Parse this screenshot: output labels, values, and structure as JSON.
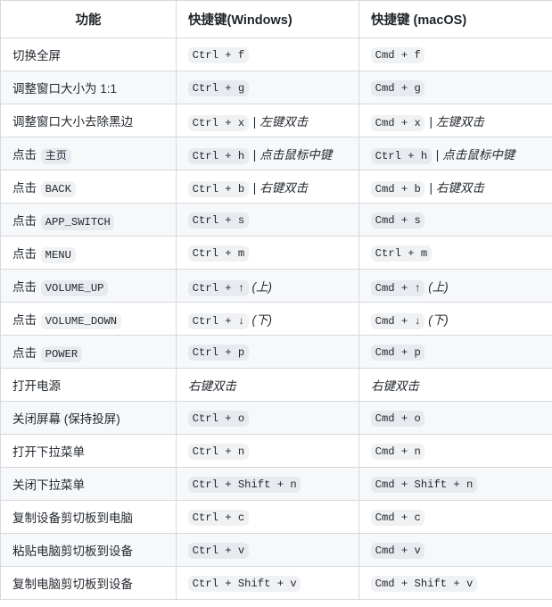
{
  "table": {
    "headers": {
      "function": "功能",
      "windows": "快捷键(Windows)",
      "macos": "快捷键 (macOS)"
    },
    "colors": {
      "border": "#d6d9dd",
      "stripe": "#f6f8fa",
      "text": "#24292f",
      "code_bg": "rgba(175,184,193,0.2)"
    },
    "rows": [
      {
        "function_text": "切换全屏",
        "function_code": "",
        "windows": {
          "code": "Ctrl + f",
          "sep": "",
          "italic": ""
        },
        "macos": {
          "code": "Cmd + f",
          "sep": "",
          "italic": ""
        }
      },
      {
        "function_text": "调整窗口大小为 1:1",
        "function_code": "",
        "windows": {
          "code": "Ctrl + g",
          "sep": "",
          "italic": ""
        },
        "macos": {
          "code": "Cmd + g",
          "sep": "",
          "italic": ""
        }
      },
      {
        "function_text": "调整窗口大小去除黑边",
        "function_code": "",
        "windows": {
          "code": "Ctrl + x",
          "sep": "|",
          "italic": "左键双击"
        },
        "macos": {
          "code": "Cmd + x",
          "sep": "|",
          "italic": "左键双击"
        }
      },
      {
        "function_text": "点击",
        "function_code": "主页",
        "windows": {
          "code": "Ctrl + h",
          "sep": "|",
          "italic": "点击鼠标中键"
        },
        "macos": {
          "code": "Ctrl + h",
          "sep": "|",
          "italic": "点击鼠标中键"
        }
      },
      {
        "function_text": "点击",
        "function_code": "BACK",
        "windows": {
          "code": "Ctrl + b",
          "sep": "|",
          "italic": "右键双击"
        },
        "macos": {
          "code": "Cmd + b",
          "sep": "|",
          "italic": "右键双击"
        }
      },
      {
        "function_text": "点击",
        "function_code": "APP_SWITCH",
        "windows": {
          "code": "Ctrl + s",
          "sep": "",
          "italic": ""
        },
        "macos": {
          "code": "Cmd + s",
          "sep": "",
          "italic": ""
        }
      },
      {
        "function_text": "点击",
        "function_code": "MENU",
        "windows": {
          "code": "Ctrl + m",
          "sep": "",
          "italic": ""
        },
        "macos": {
          "code": "Ctrl + m",
          "sep": "",
          "italic": ""
        }
      },
      {
        "function_text": "点击",
        "function_code": "VOLUME_UP",
        "windows": {
          "code": "Ctrl + ↑",
          "sep": "",
          "italic": "(上)"
        },
        "macos": {
          "code": "Cmd + ↑",
          "sep": "",
          "italic": "(上)"
        }
      },
      {
        "function_text": "点击",
        "function_code": "VOLUME_DOWN",
        "windows": {
          "code": "Ctrl + ↓",
          "sep": "",
          "italic": "(下)"
        },
        "macos": {
          "code": "Cmd + ↓",
          "sep": "",
          "italic": "(下)"
        }
      },
      {
        "function_text": "点击",
        "function_code": "POWER",
        "windows": {
          "code": "Ctrl + p",
          "sep": "",
          "italic": ""
        },
        "macos": {
          "code": "Cmd + p",
          "sep": "",
          "italic": ""
        }
      },
      {
        "function_text": "打开电源",
        "function_code": "",
        "windows": {
          "code": "",
          "sep": "",
          "italic": "右键双击"
        },
        "macos": {
          "code": "",
          "sep": "",
          "italic": "右键双击"
        }
      },
      {
        "function_text": "关闭屏幕 (保持投屏)",
        "function_code": "",
        "windows": {
          "code": "Ctrl + o",
          "sep": "",
          "italic": ""
        },
        "macos": {
          "code": "Cmd + o",
          "sep": "",
          "italic": ""
        }
      },
      {
        "function_text": "打开下拉菜单",
        "function_code": "",
        "windows": {
          "code": "Ctrl + n",
          "sep": "",
          "italic": ""
        },
        "macos": {
          "code": "Cmd + n",
          "sep": "",
          "italic": ""
        }
      },
      {
        "function_text": "关闭下拉菜单",
        "function_code": "",
        "windows": {
          "code": "Ctrl + Shift + n",
          "sep": "",
          "italic": ""
        },
        "macos": {
          "code": "Cmd + Shift + n",
          "sep": "",
          "italic": ""
        }
      },
      {
        "function_text": "复制设备剪切板到电脑",
        "function_code": "",
        "windows": {
          "code": "Ctrl + c",
          "sep": "",
          "italic": ""
        },
        "macos": {
          "code": "Cmd + c",
          "sep": "",
          "italic": ""
        }
      },
      {
        "function_text": "粘贴电脑剪切板到设备",
        "function_code": "",
        "windows": {
          "code": "Ctrl + v",
          "sep": "",
          "italic": ""
        },
        "macos": {
          "code": "Cmd + v",
          "sep": "",
          "italic": ""
        }
      },
      {
        "function_text": "复制电脑剪切板到设备",
        "function_code": "",
        "windows": {
          "code": "Ctrl + Shift + v",
          "sep": "",
          "italic": ""
        },
        "macos": {
          "code": "Cmd + Shift + v",
          "sep": "",
          "italic": ""
        }
      }
    ]
  }
}
